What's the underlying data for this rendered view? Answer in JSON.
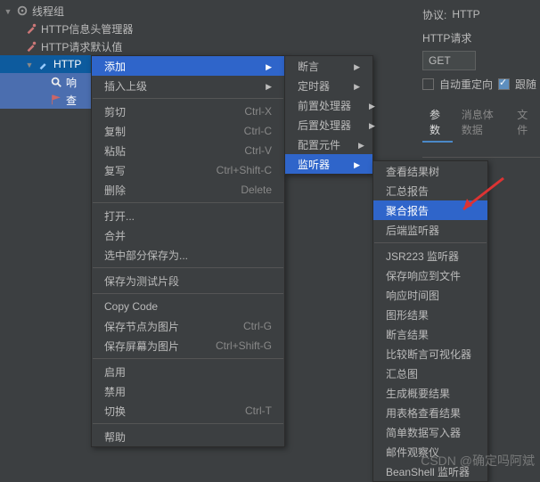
{
  "tree": {
    "root": "线程组",
    "items": [
      "HTTP信息头管理器",
      "HTTP请求默认值",
      "HTTP",
      "响",
      "查"
    ]
  },
  "right": {
    "protocol_label": "协议:",
    "protocol_value": "HTTP",
    "request_label": "HTTP请求",
    "method": "GET",
    "auto_redirect": "自动重定向",
    "follow_redirect": "跟随",
    "tabs": [
      "参数",
      "消息体数据",
      "文件"
    ]
  },
  "menu1": [
    {
      "label": "添加",
      "sc": "",
      "sub": true,
      "hl": true
    },
    {
      "label": "插入上级",
      "sc": "",
      "sub": true
    },
    {
      "sep": true
    },
    {
      "label": "剪切",
      "sc": "Ctrl-X"
    },
    {
      "label": "复制",
      "sc": "Ctrl-C"
    },
    {
      "label": "粘贴",
      "sc": "Ctrl-V"
    },
    {
      "label": "复写",
      "sc": "Ctrl+Shift-C"
    },
    {
      "label": "删除",
      "sc": "Delete"
    },
    {
      "sep": true
    },
    {
      "label": "打开..."
    },
    {
      "label": "合并"
    },
    {
      "label": "选中部分保存为..."
    },
    {
      "sep": true
    },
    {
      "label": "保存为测试片段"
    },
    {
      "sep": true
    },
    {
      "label": "Copy Code"
    },
    {
      "label": "保存节点为图片",
      "sc": "Ctrl-G"
    },
    {
      "label": "保存屏幕为图片",
      "sc": "Ctrl+Shift-G"
    },
    {
      "sep": true
    },
    {
      "label": "启用"
    },
    {
      "label": "禁用"
    },
    {
      "label": "切换",
      "sc": "Ctrl-T"
    },
    {
      "sep": true
    },
    {
      "label": "帮助"
    }
  ],
  "menu2": [
    {
      "label": "断言",
      "sub": true
    },
    {
      "label": "定时器",
      "sub": true
    },
    {
      "label": "前置处理器",
      "sub": true
    },
    {
      "label": "后置处理器",
      "sub": true
    },
    {
      "label": "配置元件",
      "sub": true
    },
    {
      "label": "监听器",
      "sub": true,
      "hl": true
    }
  ],
  "menu3": [
    {
      "label": "查看结果树"
    },
    {
      "label": "汇总报告"
    },
    {
      "label": "聚合报告",
      "hl": true
    },
    {
      "label": "后端监听器"
    },
    {
      "sep": true
    },
    {
      "label": "JSR223 监听器"
    },
    {
      "label": "保存响应到文件"
    },
    {
      "label": "响应时间图"
    },
    {
      "label": "图形结果"
    },
    {
      "label": "断言结果"
    },
    {
      "label": "比较断言可视化器"
    },
    {
      "label": "汇总图"
    },
    {
      "label": "生成概要结果"
    },
    {
      "label": "用表格查看结果"
    },
    {
      "label": "简单数据写入器"
    },
    {
      "label": "邮件观察仪"
    },
    {
      "label": "BeanShell 监听器"
    }
  ],
  "watermark": "CSDN @确定吗阿斌"
}
